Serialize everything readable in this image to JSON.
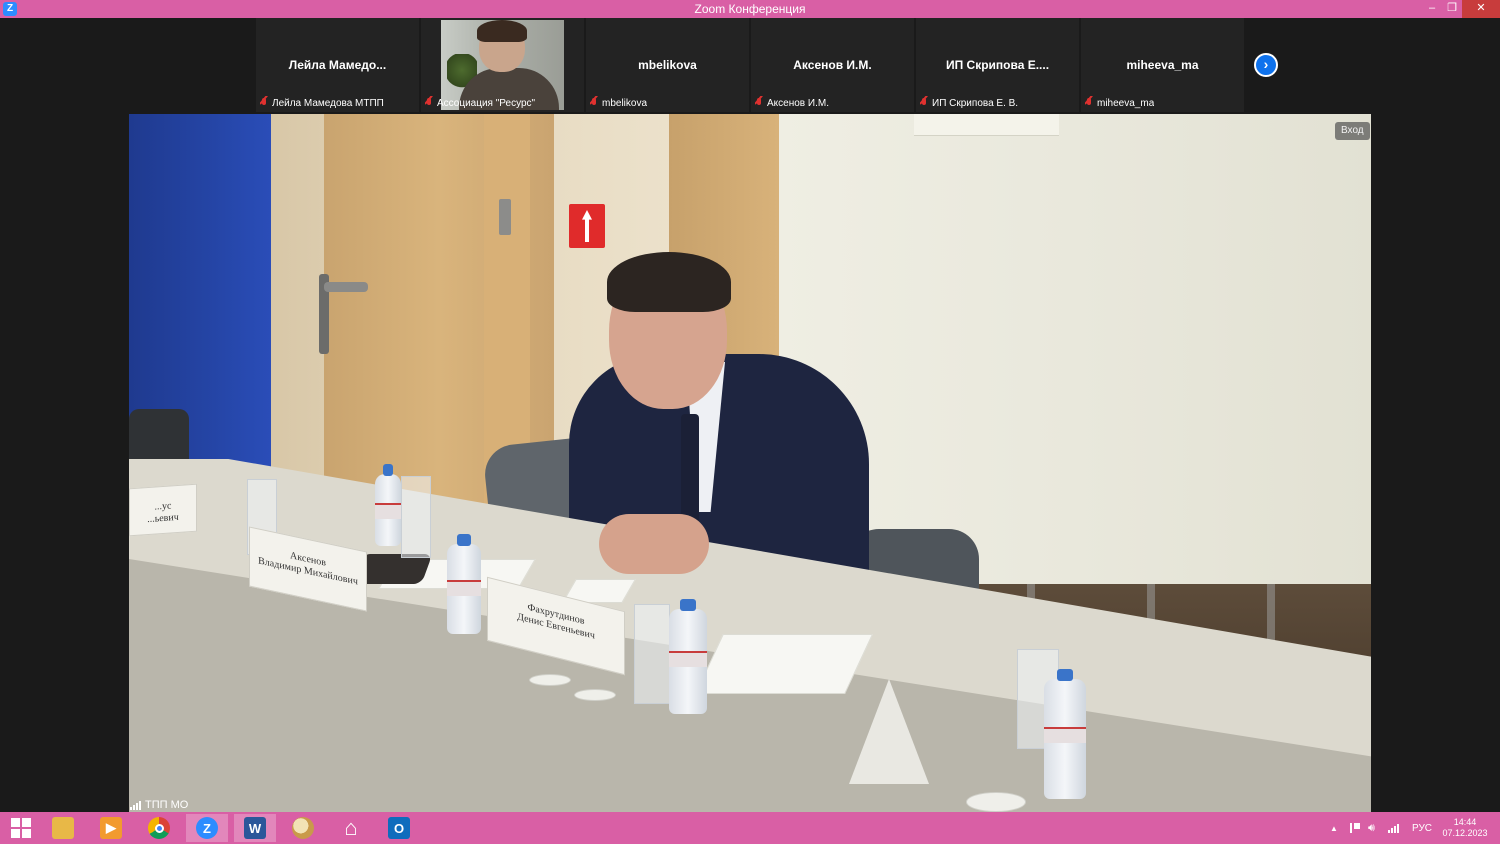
{
  "window": {
    "title": "Zoom Конференция",
    "app_icon_letter": "Z",
    "minimize_symbol": "–",
    "restore_symbol": "❐",
    "close_symbol": "✕"
  },
  "participants": [
    {
      "display_name": "Лейла  Мамедо...",
      "caption": "Лейла Мамедова МТПП",
      "has_video": false,
      "muted": true
    },
    {
      "display_name": "",
      "caption": "Ассоциация \"Ресурс\"",
      "has_video": true,
      "muted": true
    },
    {
      "display_name": "mbelikova",
      "caption": "mbelikova",
      "has_video": false,
      "muted": true
    },
    {
      "display_name": "Аксенов И.М.",
      "caption": "Аксенов И.М.",
      "has_video": false,
      "muted": true
    },
    {
      "display_name": "ИП  Скрипова  Е....",
      "caption": "ИП Скрипова Е. В.",
      "has_video": false,
      "muted": true
    },
    {
      "display_name": "miheeva_ma",
      "caption": "miheeva_ma",
      "has_video": false,
      "muted": true
    }
  ],
  "strip_next_symbol": "›",
  "main_video": {
    "speaker_label": "ТПП МО",
    "enter_badge": "Вход",
    "nameplates": [
      {
        "line1": "...ус",
        "line2": "...ьевич"
      },
      {
        "line1": "Аксенов",
        "line2": "Владимир Михайлович"
      },
      {
        "line1": "Фахрутдинов",
        "line2": "Денис Евгеньевич"
      }
    ]
  },
  "taskbar": {
    "apps": [
      {
        "name": "start",
        "icon": "windows-logo"
      },
      {
        "name": "file-explorer",
        "icon": "folder-icon"
      },
      {
        "name": "media-player",
        "icon": "media-player-icon"
      },
      {
        "name": "chrome",
        "icon": "chrome-icon"
      },
      {
        "name": "zoom",
        "icon": "zoom-icon",
        "letter": "Z"
      },
      {
        "name": "word",
        "icon": "word-icon",
        "letter": "W"
      },
      {
        "name": "paint",
        "icon": "paint-icon"
      },
      {
        "name": "home",
        "icon": "home-icon"
      },
      {
        "name": "outlook",
        "icon": "outlook-icon",
        "letter": "O"
      }
    ],
    "tray": {
      "expand_symbol": "▲",
      "language": "РУС"
    },
    "clock": {
      "time": "14:44",
      "date": "07.12.2023"
    }
  },
  "colors": {
    "titlebar": "#d95fa5",
    "taskbar": "#d95fa5",
    "zoom_blue": "#0e72ed",
    "muted_red": "#e0312f"
  }
}
